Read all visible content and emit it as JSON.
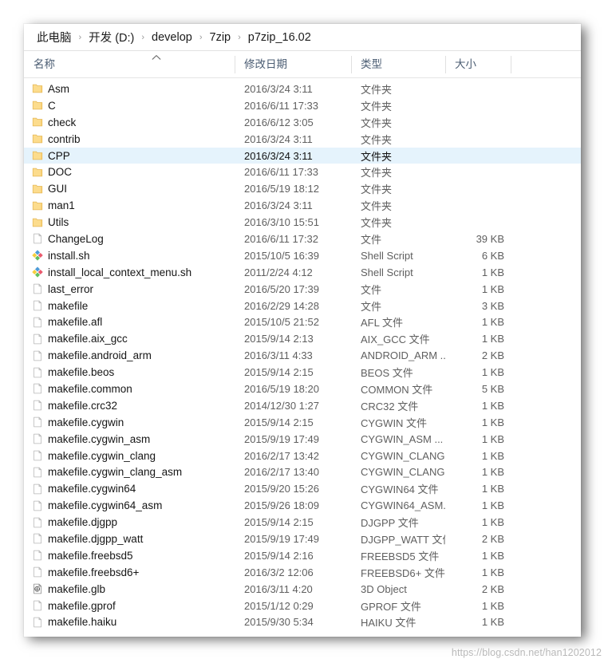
{
  "window": {
    "breadcrumb": {
      "separator": "›",
      "items": [
        "此电脑",
        "开发 (D:)",
        "develop",
        "7zip",
        "p7zip_16.02"
      ]
    },
    "columns": {
      "name": "名称",
      "date_modified": "修改日期",
      "type": "类型",
      "size": "大小",
      "sort_icon": "sort-ascending-icon",
      "sort_column": "名称",
      "sort_direction": "ascending"
    },
    "selection": {
      "selected_name": "CPP",
      "highlight_color": "#e5f3fc"
    },
    "files": [
      {
        "icon": "folder-icon",
        "name": "Asm",
        "date": "2016/3/24 3:11",
        "type": "文件夹",
        "size": ""
      },
      {
        "icon": "folder-icon",
        "name": "C",
        "date": "2016/6/11 17:33",
        "type": "文件夹",
        "size": ""
      },
      {
        "icon": "folder-icon",
        "name": "check",
        "date": "2016/6/12 3:05",
        "type": "文件夹",
        "size": ""
      },
      {
        "icon": "folder-icon",
        "name": "contrib",
        "date": "2016/3/24 3:11",
        "type": "文件夹",
        "size": ""
      },
      {
        "icon": "folder-icon",
        "name": "CPP",
        "date": "2016/3/24 3:11",
        "type": "文件夹",
        "size": "",
        "selected": true
      },
      {
        "icon": "folder-icon",
        "name": "DOC",
        "date": "2016/6/11 17:33",
        "type": "文件夹",
        "size": ""
      },
      {
        "icon": "folder-icon",
        "name": "GUI",
        "date": "2016/5/19 18:12",
        "type": "文件夹",
        "size": ""
      },
      {
        "icon": "folder-icon",
        "name": "man1",
        "date": "2016/3/24 3:11",
        "type": "文件夹",
        "size": ""
      },
      {
        "icon": "folder-icon",
        "name": "Utils",
        "date": "2016/3/10 15:51",
        "type": "文件夹",
        "size": ""
      },
      {
        "icon": "file-icon",
        "name": "ChangeLog",
        "date": "2016/6/11 17:32",
        "type": "文件",
        "size": "39 KB"
      },
      {
        "icon": "shell-script-icon",
        "name": "install.sh",
        "date": "2015/10/5 16:39",
        "type": "Shell Script",
        "size": "6 KB"
      },
      {
        "icon": "shell-script-icon",
        "name": "install_local_context_menu.sh",
        "date": "2011/2/24 4:12",
        "type": "Shell Script",
        "size": "1 KB"
      },
      {
        "icon": "file-icon",
        "name": "last_error",
        "date": "2016/5/20 17:39",
        "type": "文件",
        "size": "1 KB"
      },
      {
        "icon": "file-icon",
        "name": "makefile",
        "date": "2016/2/29 14:28",
        "type": "文件",
        "size": "3 KB"
      },
      {
        "icon": "file-icon",
        "name": "makefile.afl",
        "date": "2015/10/5 21:52",
        "type": "AFL 文件",
        "size": "1 KB"
      },
      {
        "icon": "file-icon",
        "name": "makefile.aix_gcc",
        "date": "2015/9/14 2:13",
        "type": "AIX_GCC 文件",
        "size": "1 KB"
      },
      {
        "icon": "file-icon",
        "name": "makefile.android_arm",
        "date": "2016/3/11 4:33",
        "type": "ANDROID_ARM ...",
        "size": "2 KB"
      },
      {
        "icon": "file-icon",
        "name": "makefile.beos",
        "date": "2015/9/14 2:15",
        "type": "BEOS 文件",
        "size": "1 KB"
      },
      {
        "icon": "file-icon",
        "name": "makefile.common",
        "date": "2016/5/19 18:20",
        "type": "COMMON 文件",
        "size": "5 KB"
      },
      {
        "icon": "file-icon",
        "name": "makefile.crc32",
        "date": "2014/12/30 1:27",
        "type": "CRC32 文件",
        "size": "1 KB"
      },
      {
        "icon": "file-icon",
        "name": "makefile.cygwin",
        "date": "2015/9/14 2:15",
        "type": "CYGWIN 文件",
        "size": "1 KB"
      },
      {
        "icon": "file-icon",
        "name": "makefile.cygwin_asm",
        "date": "2015/9/19 17:49",
        "type": "CYGWIN_ASM ...",
        "size": "1 KB"
      },
      {
        "icon": "file-icon",
        "name": "makefile.cygwin_clang",
        "date": "2016/2/17 13:42",
        "type": "CYGWIN_CLANG...",
        "size": "1 KB"
      },
      {
        "icon": "file-icon",
        "name": "makefile.cygwin_clang_asm",
        "date": "2016/2/17 13:40",
        "type": "CYGWIN_CLANG...",
        "size": "1 KB"
      },
      {
        "icon": "file-icon",
        "name": "makefile.cygwin64",
        "date": "2015/9/20 15:26",
        "type": "CYGWIN64 文件",
        "size": "1 KB"
      },
      {
        "icon": "file-icon",
        "name": "makefile.cygwin64_asm",
        "date": "2015/9/26 18:09",
        "type": "CYGWIN64_ASM...",
        "size": "1 KB"
      },
      {
        "icon": "file-icon",
        "name": "makefile.djgpp",
        "date": "2015/9/14 2:15",
        "type": "DJGPP 文件",
        "size": "1 KB"
      },
      {
        "icon": "file-icon",
        "name": "makefile.djgpp_watt",
        "date": "2015/9/19 17:49",
        "type": "DJGPP_WATT 文件",
        "size": "2 KB"
      },
      {
        "icon": "file-icon",
        "name": "makefile.freebsd5",
        "date": "2015/9/14 2:16",
        "type": "FREEBSD5 文件",
        "size": "1 KB"
      },
      {
        "icon": "file-icon",
        "name": "makefile.freebsd6+",
        "date": "2016/3/2 12:06",
        "type": "FREEBSD6+ 文件",
        "size": "1 KB"
      },
      {
        "icon": "3d-object-icon",
        "name": "makefile.glb",
        "date": "2016/3/11 4:20",
        "type": "3D Object",
        "size": "2 KB"
      },
      {
        "icon": "file-icon",
        "name": "makefile.gprof",
        "date": "2015/1/12 0:29",
        "type": "GPROF 文件",
        "size": "1 KB"
      },
      {
        "icon": "file-icon",
        "name": "makefile.haiku",
        "date": "2015/9/30 5:34",
        "type": "HAIKU 文件",
        "size": "1 KB"
      }
    ]
  },
  "watermark": {
    "text": "https://blog.csdn.net/han1202012"
  },
  "colors": {
    "folder": "#fcdc8d",
    "folder_edge": "#e9b94b",
    "selection": "#e5f3fc",
    "header_text": "#4b5d73",
    "body_text": "#161616",
    "meta_text": "#5f5f5f"
  }
}
